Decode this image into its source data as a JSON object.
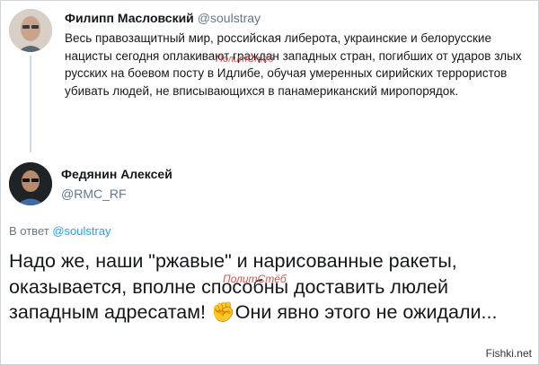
{
  "tweet1": {
    "author_name": "Филипп Масловский",
    "author_handle": "@soulstray",
    "text": "Весь правозащитный мир, российская либерота, украинские и белорусские нацисты сегодня оплакивают граждан западных стран, погибших от ударов злых русских на боевом посту в Идлибе, обучая умеренных сирийских террористов убивать людей, не вписывающихся в панамериканский миропорядок."
  },
  "tweet2": {
    "author_name": "Федянин Алексей",
    "author_handle": "@RMC_RF",
    "reply_prefix": "В ответ",
    "reply_to": "@soulstray",
    "text_before_emoji": "Надо же, наши \"ржавые\" и нарисованные ракеты, оказывается, вполне способны доставить люлей западным адресатам!",
    "emoji": "✊",
    "text_after_emoji": "Они явно этого не ожидали..."
  },
  "watermark_label": "ПолитСтёб",
  "site_watermark": "Fishki.net",
  "colors": {
    "link": "#1da1f2",
    "muted": "#657786",
    "watermark": "#d9534f"
  }
}
